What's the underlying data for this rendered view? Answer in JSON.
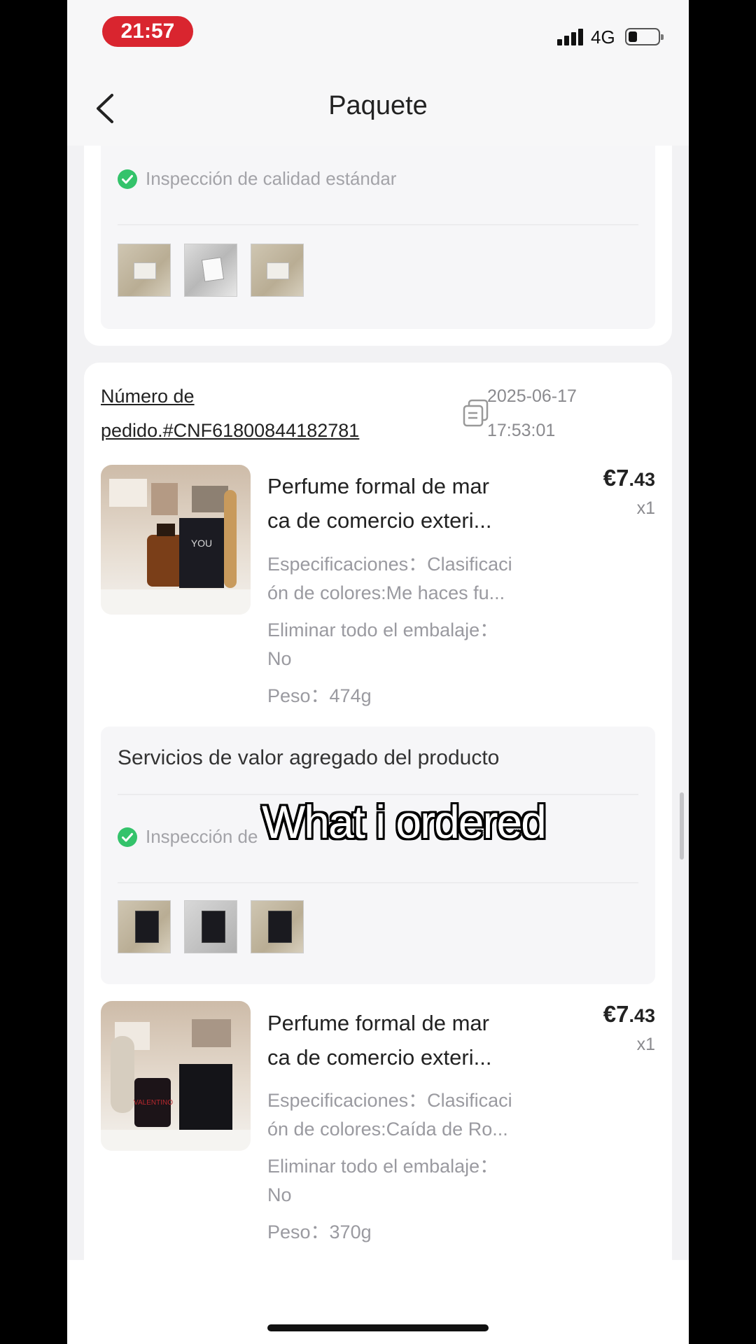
{
  "status_bar": {
    "time": "21:57",
    "network": "4G"
  },
  "header": {
    "title": "Paquete"
  },
  "top_card": {
    "quality_inspection": "Inspección de calidad estándar"
  },
  "order": {
    "number_label_line1": "Número de",
    "number_label_line2": "pedido.#CNF61800844182781",
    "date": "2025-06-17",
    "time": "17:53:01"
  },
  "products": [
    {
      "name_line1": "Perfume formal de mar",
      "name_line2": "ca de comercio exteri...",
      "price_main": "€7",
      "price_decimal": ".43",
      "quantity": "x1",
      "spec_line1": "Especificaciones：Clasificaci",
      "spec_line2": "ón de colores:Me haces fu...",
      "packaging_line1": "Eliminar todo el embalaje：",
      "packaging_line2": "No",
      "weight": "Peso：474g",
      "image_label": "YOU"
    },
    {
      "name_line1": "Perfume formal de mar",
      "name_line2": "ca de comercio exteri...",
      "price_main": "€7",
      "price_decimal": ".43",
      "quantity": "x1",
      "spec_line1": "Especificaciones：Clasificaci",
      "spec_line2": "ón de colores:Caída de Ro...",
      "packaging_line1": "Eliminar todo el embalaje：",
      "packaging_line2": "No",
      "weight": "Peso：370g",
      "image_label": "VALENTINO"
    }
  ],
  "services": {
    "title": "Servicios de valor agregado del producto",
    "quality_inspection_partial": "Inspección de"
  },
  "overlay": {
    "caption": "What i ordered"
  },
  "colors": {
    "time_pill": "#d9252f",
    "check_green": "#34c36b",
    "background": "#f2f2f4"
  }
}
